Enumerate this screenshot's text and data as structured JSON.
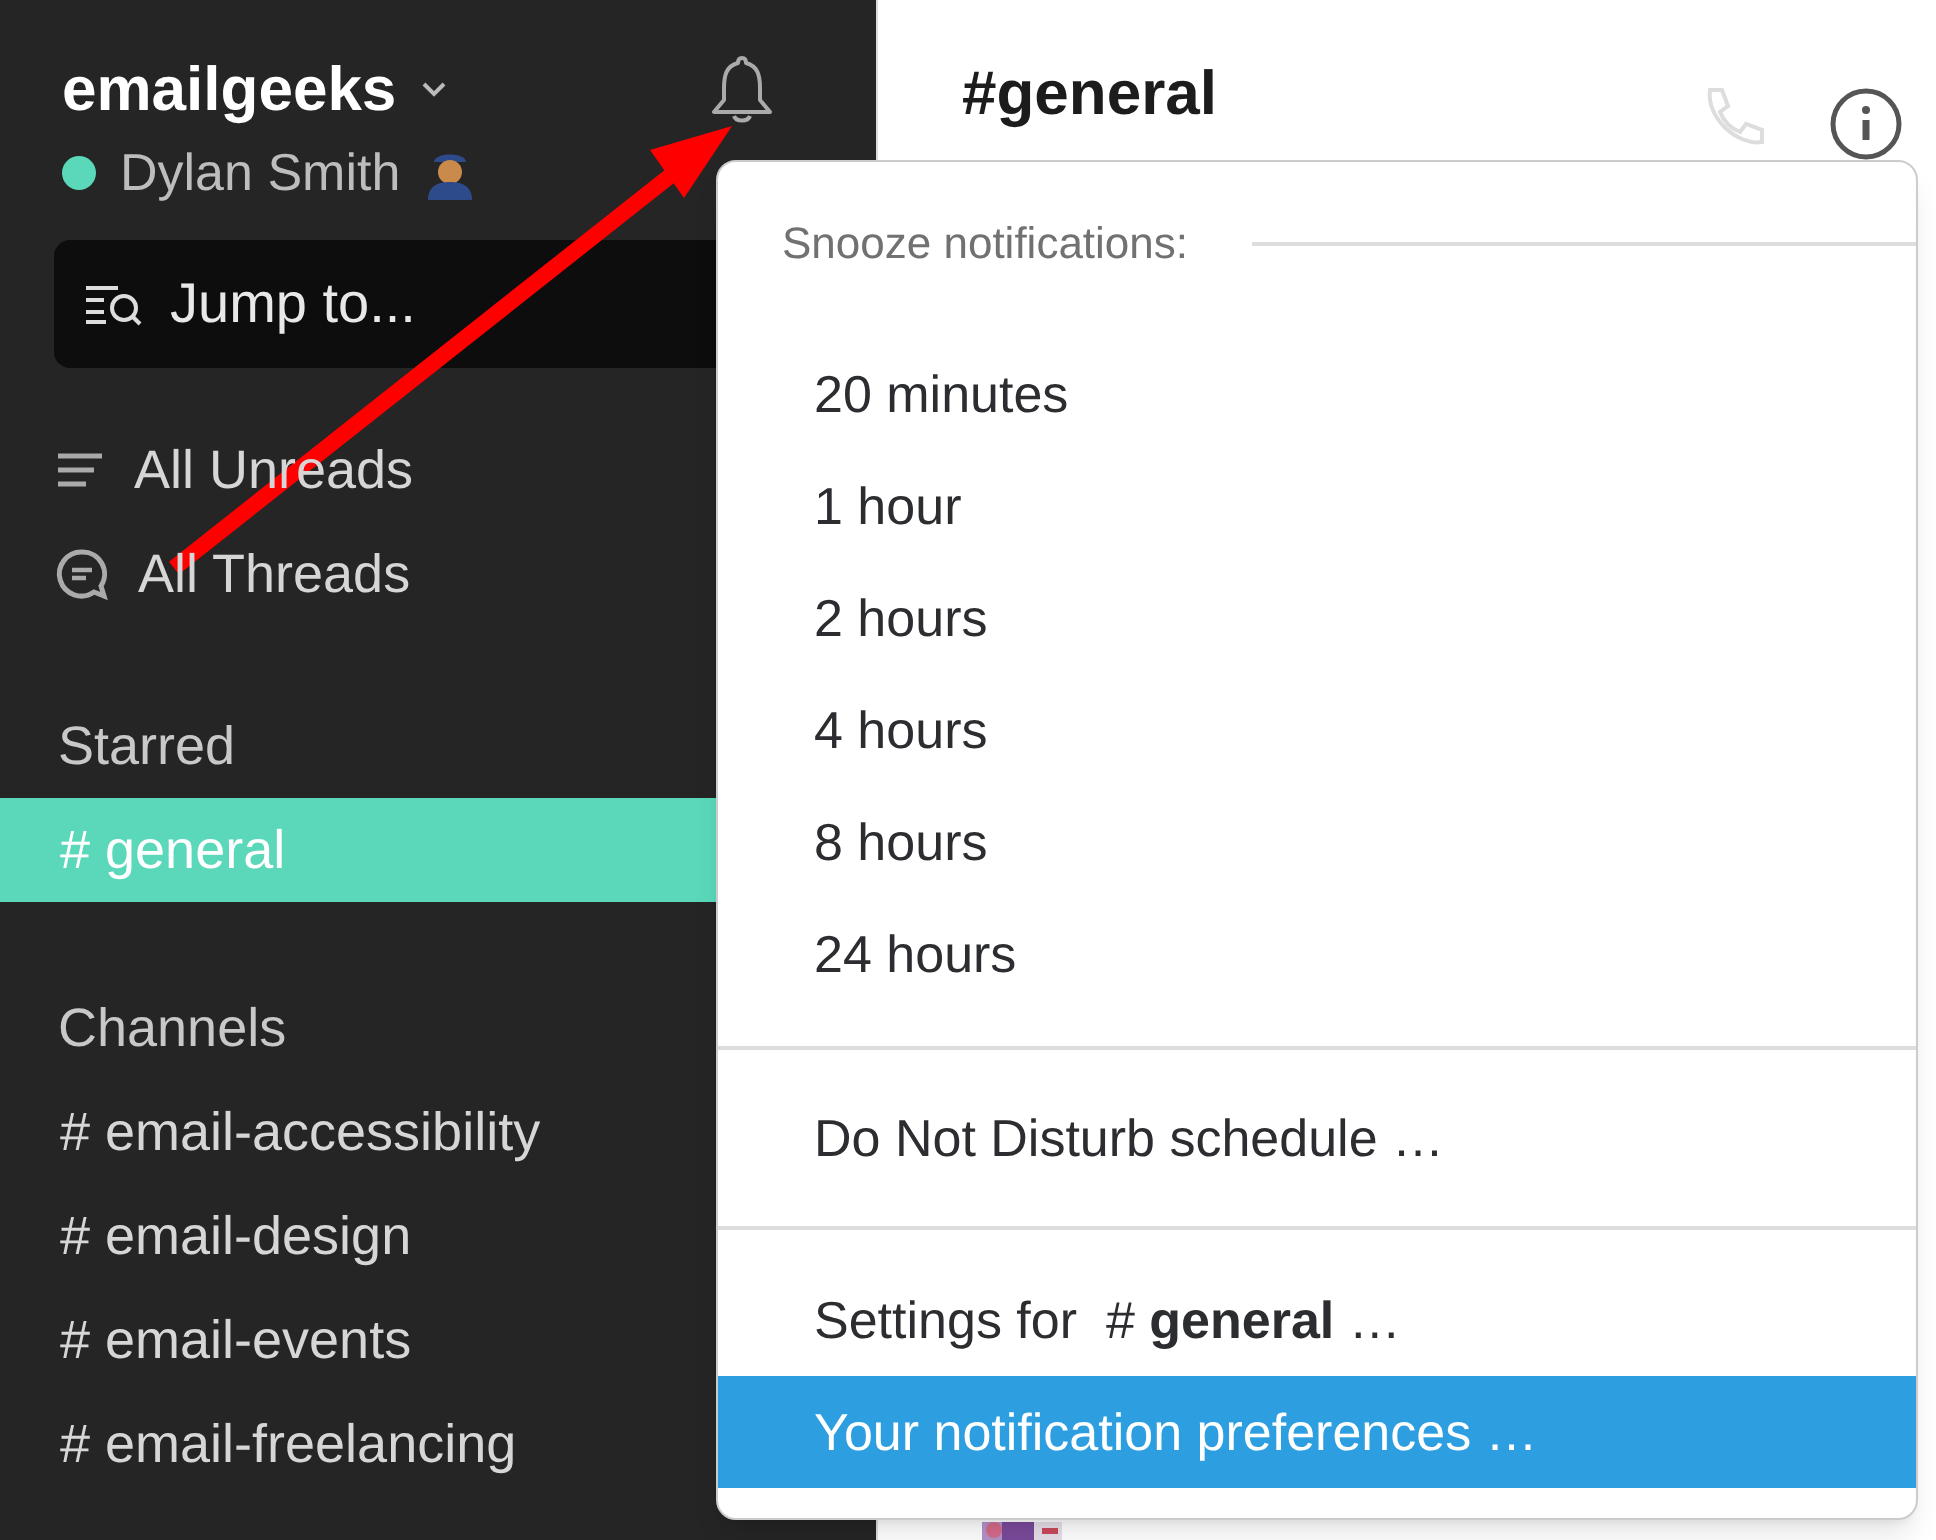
{
  "sidebar": {
    "workspace": "emailgeeks",
    "user": {
      "name": "Dylan Smith",
      "online": true
    },
    "jump_to": {
      "placeholder": "Jump to..."
    },
    "nav": [
      {
        "kind": "unreads",
        "label": "All Unreads"
      },
      {
        "kind": "threads",
        "label": "All Threads"
      }
    ],
    "sections": [
      {
        "title": "Starred",
        "channels": [
          {
            "prefix": "#",
            "name": "general",
            "selected": true
          }
        ]
      },
      {
        "title": "Channels",
        "channels": [
          {
            "prefix": "#",
            "name": "email-accessibility",
            "selected": false
          },
          {
            "prefix": "#",
            "name": "email-design",
            "selected": false
          },
          {
            "prefix": "#",
            "name": "email-events",
            "selected": false
          },
          {
            "prefix": "#",
            "name": "email-freelancing",
            "selected": false
          }
        ]
      }
    ]
  },
  "channel_header": {
    "title": "#general"
  },
  "snooze_menu": {
    "heading": "Snooze notifications:",
    "durations": [
      {
        "label": "20 minutes",
        "selected": false
      },
      {
        "label": "1 hour",
        "selected": false
      },
      {
        "label": "2 hours",
        "selected": false
      },
      {
        "label": "4 hours",
        "selected": false
      },
      {
        "label": "8 hours",
        "selected": false
      },
      {
        "label": "24 hours",
        "selected": false
      }
    ],
    "schedule": [
      {
        "label": "Do Not Disturb schedule …",
        "selected": false
      }
    ],
    "settings": [
      {
        "label": "Settings for  # **general** …",
        "selected": false
      },
      {
        "label": "Your notification preferences …",
        "selected": true
      }
    ]
  }
}
